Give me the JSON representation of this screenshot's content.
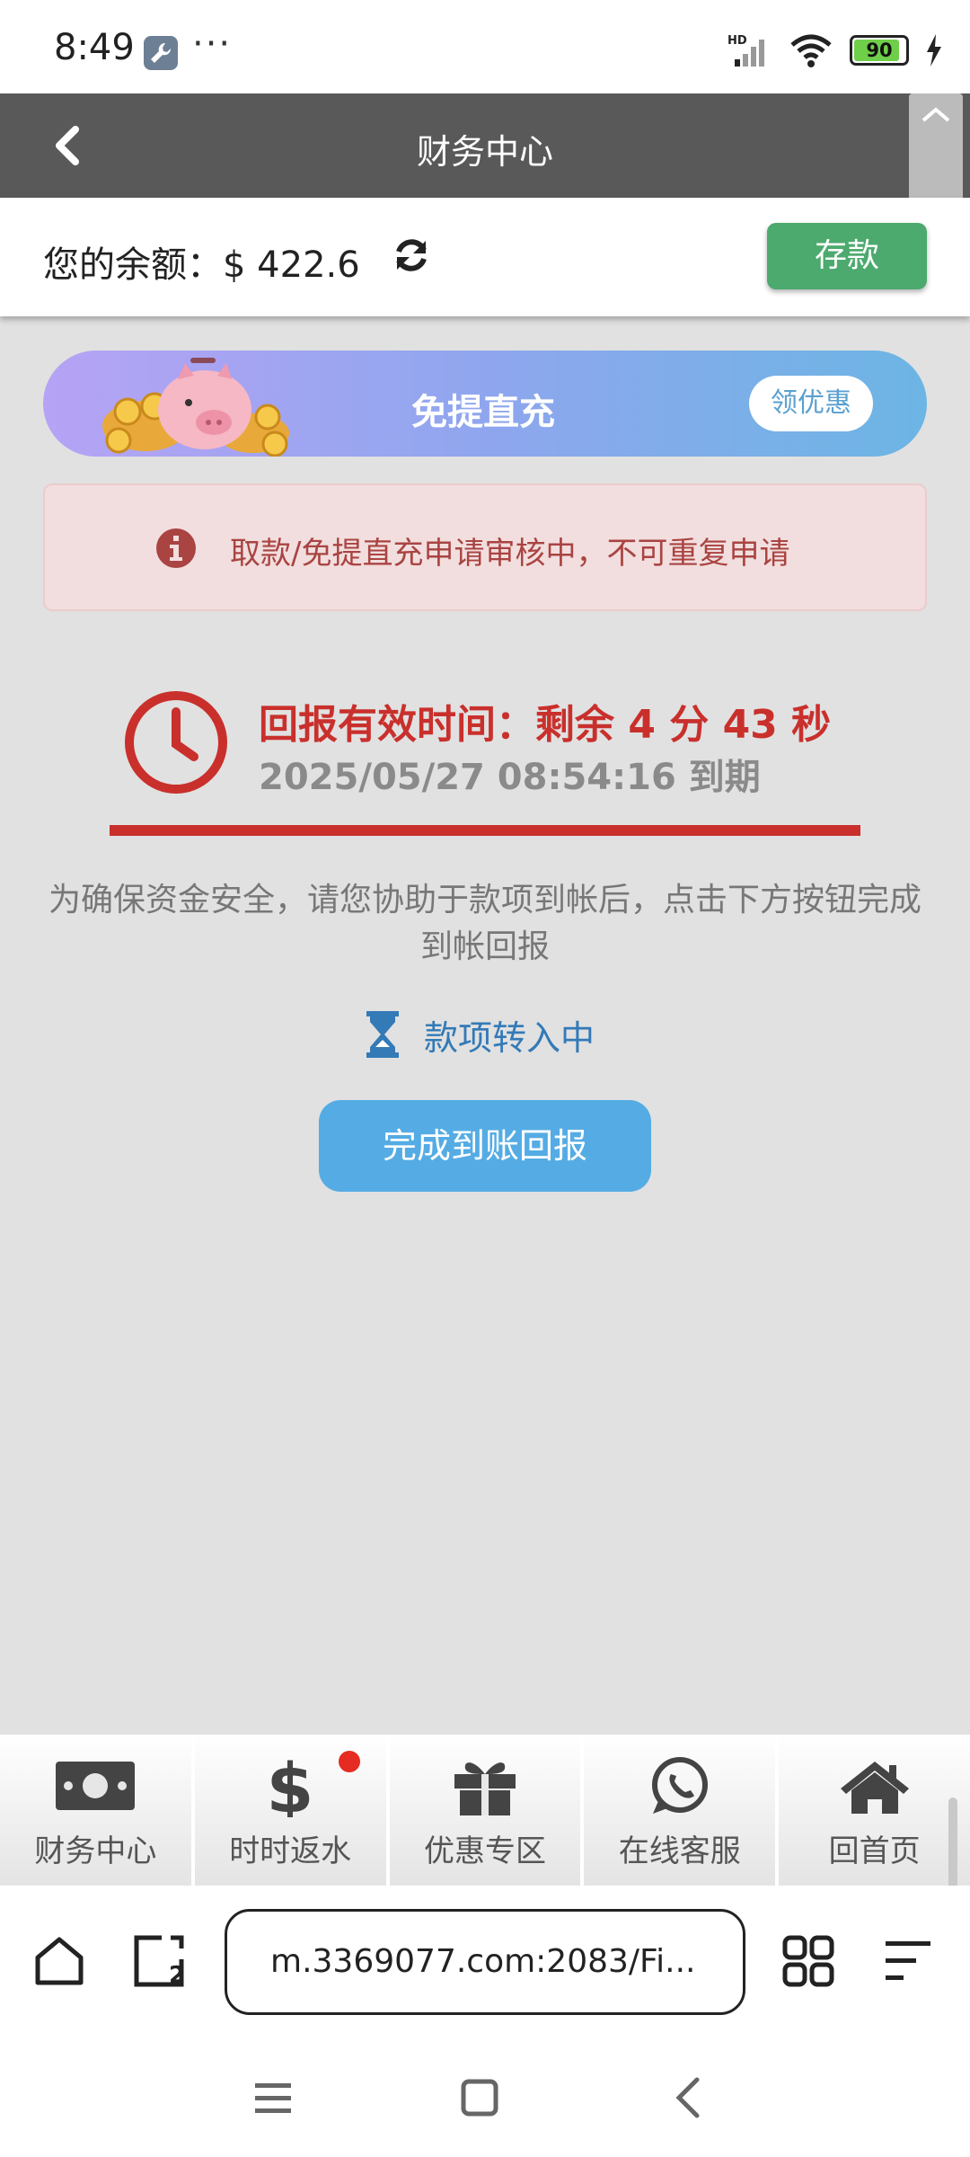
{
  "status_bar": {
    "time": "8:49",
    "more": "···",
    "network": "HD",
    "battery": "90",
    "icons": [
      "wrench-icon",
      "signal-icon",
      "wifi-icon",
      "battery-icon",
      "charging-icon"
    ]
  },
  "header": {
    "title": "财务中心",
    "back_icon": "chevron-left-icon"
  },
  "balance": {
    "label": "您的余额：",
    "amount": "$ 422.6",
    "refresh_icon": "refresh-icon",
    "deposit_label": "存款",
    "deposit_color": "#4caa6e"
  },
  "promo": {
    "title": "免提直充",
    "button_label": "领优惠",
    "image": "piggy-bank-coins"
  },
  "alert": {
    "text": "取款/免提直充申请审核中，不可重复申请",
    "icon": "info-icon",
    "color": "#a94442"
  },
  "countdown": {
    "main": "回报有效时间：剩余 4 分 43 秒",
    "expiry": "2025/05/27 08:54:16 到期",
    "icon": "clock-icon",
    "color": "#c9302c"
  },
  "instructions": "为确保资金安全，请您协助于款项到帐后，点击下方按钮完成到帐回报",
  "transfer_status": {
    "text": "款项转入中",
    "icon": "hourglass-icon"
  },
  "confirm_button": "完成到账回报",
  "bottom_nav": {
    "items": [
      {
        "label": "财务中心",
        "icon": "money-bill-icon"
      },
      {
        "label": "时时返水",
        "icon": "dollar-icon"
      },
      {
        "label": "优惠专区",
        "icon": "gift-icon"
      },
      {
        "label": "在线客服",
        "icon": "whatsapp-icon"
      },
      {
        "label": "回首页",
        "icon": "home-icon"
      }
    ]
  },
  "browser": {
    "url": "m.3369077.com:2083/Fi...",
    "tab_count": "2"
  }
}
